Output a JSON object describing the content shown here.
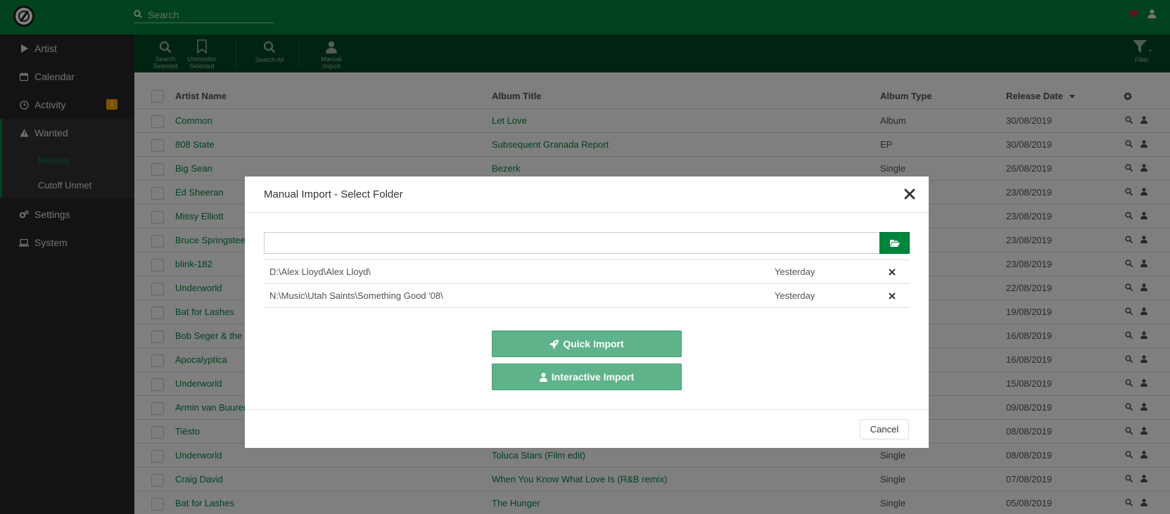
{
  "header": {
    "search_placeholder": "Search",
    "heart_color": "#c4273c"
  },
  "sidebar": {
    "items": [
      {
        "label": "Artist",
        "icon": "play-icon"
      },
      {
        "label": "Calendar",
        "icon": "calendar-icon"
      },
      {
        "label": "Activity",
        "icon": "clock-icon",
        "badge": "1"
      },
      {
        "label": "Wanted",
        "icon": "warning-icon",
        "active": true
      },
      {
        "label": "Missing",
        "sub": true,
        "active": true
      },
      {
        "label": "Cutoff Unmet",
        "sub": true
      },
      {
        "label": "Settings",
        "icon": "cogs-icon"
      },
      {
        "label": "System",
        "icon": "laptop-icon"
      }
    ]
  },
  "toolbar": {
    "search_selected_1": "Search",
    "search_selected_2": "Selected",
    "unmonitor_1": "Unmonitor",
    "unmonitor_2": "Selected",
    "search_all": "Search All",
    "manual_import_1": "Manual",
    "manual_import_2": "Import",
    "filter": "Filter"
  },
  "table": {
    "columns": {
      "artist": "Artist Name",
      "album": "Album Title",
      "type": "Album Type",
      "date": "Release Date"
    },
    "rows": [
      {
        "artist": "Common",
        "album": "Let Love",
        "type": "Album",
        "date": "30/08/2019"
      },
      {
        "artist": "808 State",
        "album": "Subsequent Granada Report",
        "type": "EP",
        "date": "30/08/2019"
      },
      {
        "artist": "Big Sean",
        "album": "Bezerk",
        "type": "Single",
        "date": "26/08/2019"
      },
      {
        "artist": "Ed Sheeran",
        "album": "",
        "type": "",
        "date": "23/08/2019"
      },
      {
        "artist": "Missy Elliott",
        "album": "",
        "type": "",
        "date": "23/08/2019"
      },
      {
        "artist": "Bruce Springsteen",
        "album": "",
        "type": "",
        "date": "23/08/2019"
      },
      {
        "artist": "blink-182",
        "album": "",
        "type": "",
        "date": "23/08/2019"
      },
      {
        "artist": "Underworld",
        "album": "",
        "type": "",
        "date": "22/08/2019"
      },
      {
        "artist": "Bat for Lashes",
        "album": "",
        "type": "",
        "date": "19/08/2019"
      },
      {
        "artist": "Bob Seger & the S",
        "album": "",
        "type": "",
        "date": "16/08/2019"
      },
      {
        "artist": "Apocalyptica",
        "album": "",
        "type": "",
        "date": "16/08/2019"
      },
      {
        "artist": "Underworld",
        "album": "",
        "type": "",
        "date": "15/08/2019"
      },
      {
        "artist": "Armin van Buuren",
        "album": "",
        "type": "",
        "date": "09/08/2019"
      },
      {
        "artist": "Tiësto",
        "album": "",
        "type": "",
        "date": "08/08/2019"
      },
      {
        "artist": "Underworld",
        "album": "Toluca Stars (Film edit)",
        "type": "Single",
        "date": "08/08/2019"
      },
      {
        "artist": "Craig David",
        "album": "When You Know What Love Is (R&B remix)",
        "type": "Single",
        "date": "07/08/2019"
      },
      {
        "artist": "Bat for Lashes",
        "album": "The Hunger",
        "type": "Single",
        "date": "05/08/2019"
      }
    ]
  },
  "modal": {
    "title": "Manual Import - Select Folder",
    "path_value": "",
    "recent": [
      {
        "path": "D:\\Alex Lloyd\\Alex Lloyd\\",
        "when": "Yesterday"
      },
      {
        "path": "N:\\Music\\Utah Saints\\Something Good '08\\",
        "when": "Yesterday"
      }
    ],
    "quick_import": "Quick Import",
    "interactive_import": "Interactive Import",
    "cancel": "Cancel"
  }
}
